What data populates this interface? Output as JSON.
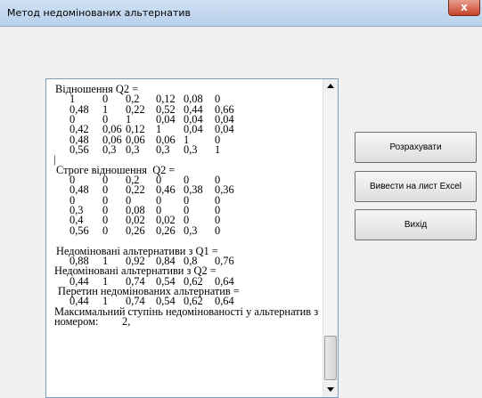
{
  "window": {
    "title": "Метод недомінованих альтернатив",
    "close_glyph": "x"
  },
  "buttons": {
    "calculate": "Розрахувати",
    "export_excel": "Вивести на лист Excel",
    "exit": "Вихід"
  },
  "output": {
    "relation_q2_header": "Відношення Q2 =",
    "relation_q2": [
      [
        "1",
        "0",
        "0,2",
        "0,12",
        "0,08",
        "0"
      ],
      [
        "0,48",
        "1",
        "0,22",
        "0,52",
        "0,44",
        "0,66"
      ],
      [
        "0",
        "0",
        "1",
        "0,04",
        "0,04",
        "0,04"
      ],
      [
        "0,42",
        "0,06",
        "0,12",
        "1",
        "0,04",
        "0,04"
      ],
      [
        "0,48",
        "0,06",
        "0,06",
        "0,06",
        "1",
        "0"
      ],
      [
        "0,56",
        "0,3",
        "0,3",
        "0,3",
        "0,3",
        "1"
      ]
    ],
    "cursor": "|",
    "strict_q2_header": "Строге відношення  Q2 =",
    "strict_q2": [
      [
        "0",
        "0",
        "0,2",
        "0",
        "0",
        "0"
      ],
      [
        "0,48",
        "0",
        "0,22",
        "0,46",
        "0,38",
        "0,36"
      ],
      [
        "0",
        "0",
        "0",
        "0",
        "0",
        "0"
      ],
      [
        "0,3",
        "0",
        "0,08",
        "0",
        "0",
        "0"
      ],
      [
        "0,4",
        "0",
        "0,02",
        "0,02",
        "0",
        "0"
      ],
      [
        "0,56",
        "0",
        "0,26",
        "0,26",
        "0,3",
        "0"
      ]
    ],
    "nondom_q1_header": "Недоміновані альтернативи з Q1 =",
    "nondom_q1": [
      "0,88",
      "1",
      "0,92",
      "0,84",
      "0,8",
      "0,76"
    ],
    "nondom_q2_header": "Недоміновані альтернативи з Q2 =",
    "nondom_q2": [
      "0,44",
      "1",
      "0,74",
      "0,54",
      "0,62",
      "0,64"
    ],
    "intersection_header": "Перетин недомінованих альтернатив =",
    "intersection": [
      "0,44",
      "1",
      "0,74",
      "0,54",
      "0,62",
      "0,64"
    ],
    "max_degree_line1": "Максимальний ступінь недомінованості у альтернатив з",
    "max_degree_label": "номером:",
    "max_degree_value": "2,"
  }
}
